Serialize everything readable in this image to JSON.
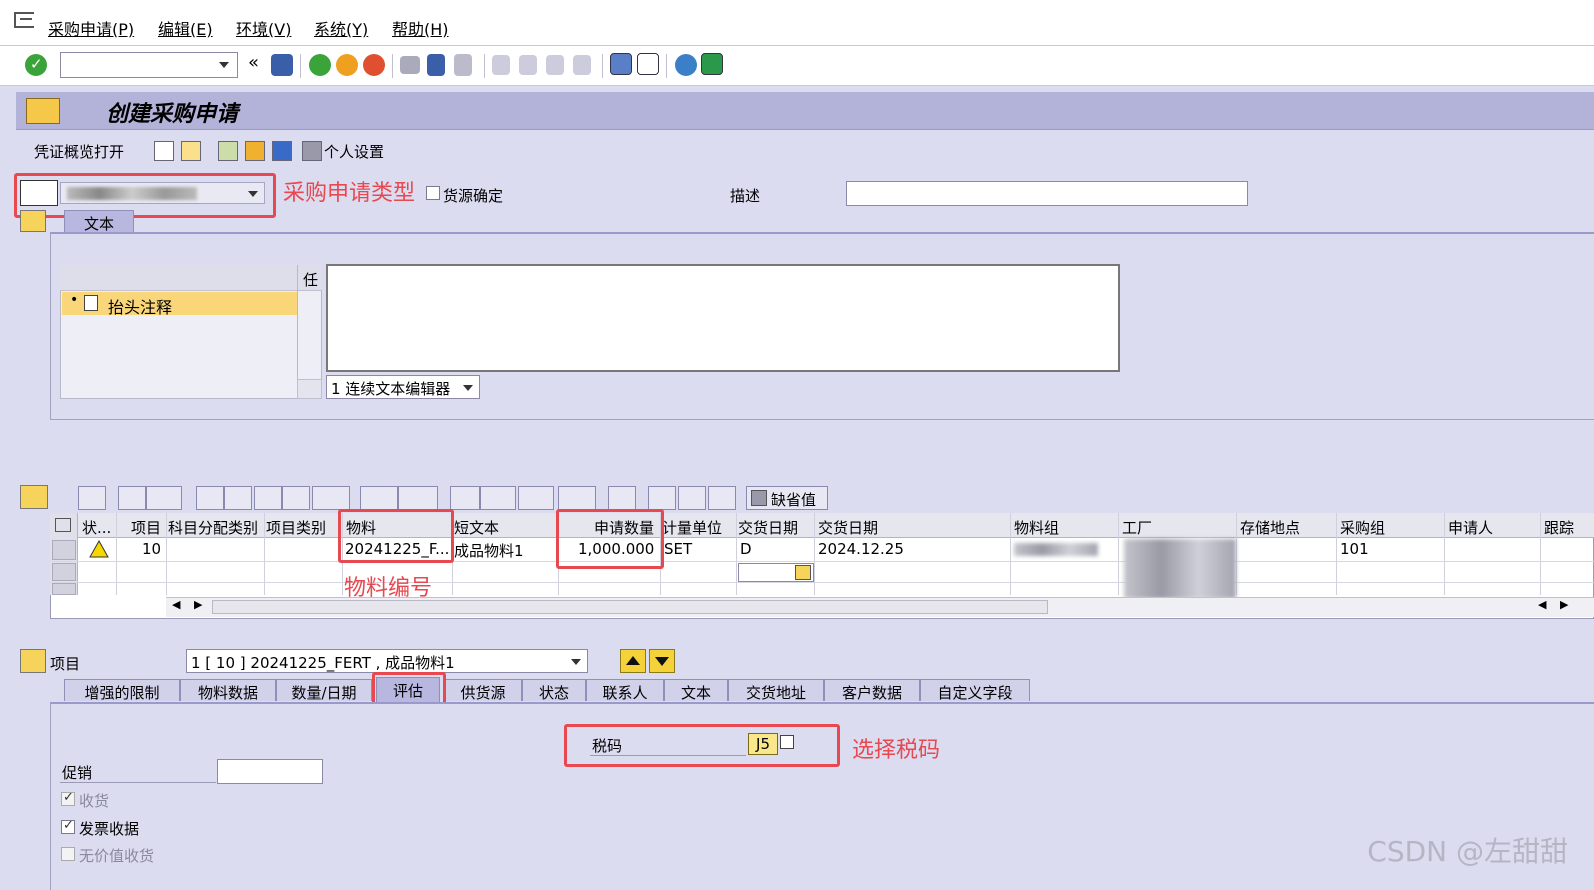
{
  "menu": {
    "items": [
      "采购申请(P)",
      "编辑(E)",
      "环境(V)",
      "系统(Y)",
      "帮助(H)"
    ]
  },
  "title": "创建采购申请",
  "app_toolbar": {
    "doc_overview": "凭证概览打开",
    "personal_settings": "个人设置"
  },
  "header": {
    "source_determination_label": "货源确定",
    "description_label": "描述",
    "description_value": ""
  },
  "header_tabs": [
    "文本"
  ],
  "text_panel": {
    "col_header": "任",
    "tree_item": "抬头注释",
    "editor_mode": "1 连续文本编辑器"
  },
  "item_toolbar": {
    "default_values": "缺省值"
  },
  "grid": {
    "columns": [
      "状...",
      "项目",
      "科目分配类别",
      "项目类别",
      "物料",
      "短文本",
      "申请数量",
      "计量单位",
      "交货日期",
      "交货日期",
      "物料组",
      "工厂",
      "存储地点",
      "采购组",
      "申请人",
      "跟踪"
    ],
    "row": {
      "item": "10",
      "material": "20241225_F...",
      "short_text": "成品物料1",
      "quantity": "1,000.000",
      "unit": "SET",
      "date_type": "D",
      "delivery_date": "2024.12.25",
      "purch_group": "101"
    }
  },
  "item_detail": {
    "label": "项目",
    "selected": "1 [ 10 ] 20241225_FERT , 成品物料1",
    "tabs": [
      "增强的限制",
      "物料数据",
      "数量/日期",
      "评估",
      "供货源",
      "状态",
      "联系人",
      "文本",
      "交货地址",
      "客户数据",
      "自定义字段"
    ],
    "tax_code_label": "税码",
    "tax_code_value": "J5",
    "promotion_label": "促销",
    "gr_label": "收货",
    "ir_label": "发票收据",
    "non_valuated_gr_label": "无价值收货"
  },
  "annotations": {
    "pr_type": "采购申请类型",
    "material_no": "物料编号",
    "select_tax": "选择税码",
    "color": "#e8484f"
  },
  "watermark": "CSDN @左甜甜"
}
